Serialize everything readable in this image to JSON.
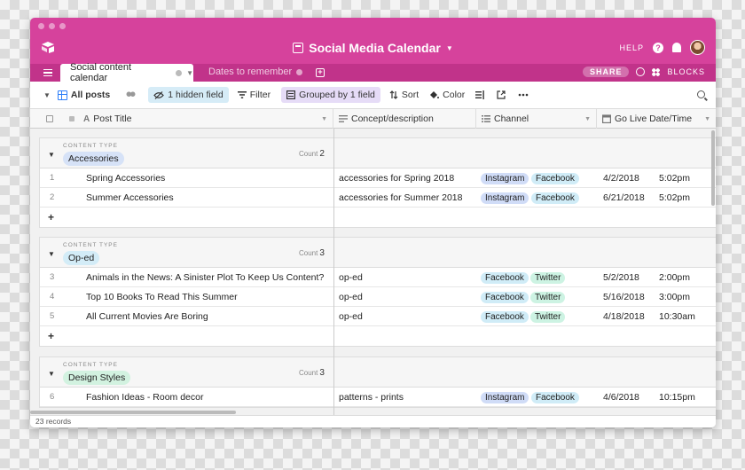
{
  "app": {
    "title": "Social Media Calendar",
    "help_label": "HELP",
    "help_glyph": "?",
    "share_label": "SHARE",
    "blocks_label": "BLOCKS",
    "brand_color": "#d6429c"
  },
  "tabs": {
    "active": "Social content calendar",
    "inactive": "Dates to remember",
    "add_glyph": "+"
  },
  "toolbar": {
    "view_name": "All posts",
    "hidden_fields": "1 hidden field",
    "filter": "Filter",
    "grouped": "Grouped by 1 field",
    "sort": "Sort",
    "color": "Color"
  },
  "columns": {
    "post_title": "Post Title",
    "concept": "Concept/description",
    "channel": "Channel",
    "golive": "Go Live Date/Time"
  },
  "groups": [
    {
      "type_label": "CONTENT TYPE",
      "name": "Accessories",
      "count_label": "Count",
      "count": "2",
      "rows": [
        {
          "num": "1",
          "title": "Spring Accessories",
          "concept": "accessories for Spring 2018",
          "channels": [
            "Instagram",
            "Facebook"
          ],
          "date": "4/2/2018",
          "time": "5:02pm"
        },
        {
          "num": "2",
          "title": "Summer Accessories",
          "concept": "accessories for Summer 2018",
          "channels": [
            "Instagram",
            "Facebook"
          ],
          "date": "6/21/2018",
          "time": "5:02pm"
        }
      ]
    },
    {
      "type_label": "CONTENT TYPE",
      "name": "Op-ed",
      "count_label": "Count",
      "count": "3",
      "rows": [
        {
          "num": "3",
          "title": "Animals in the News: A Sinister Plot To Keep Us Content?",
          "concept": "op-ed",
          "channels": [
            "Facebook",
            "Twitter"
          ],
          "date": "5/2/2018",
          "time": "2:00pm"
        },
        {
          "num": "4",
          "title": "Top 10 Books To Read This Summer",
          "concept": "op-ed",
          "channels": [
            "Facebook",
            "Twitter"
          ],
          "date": "5/16/2018",
          "time": "3:00pm"
        },
        {
          "num": "5",
          "title": "All Current Movies Are Boring",
          "concept": "op-ed",
          "channels": [
            "Facebook",
            "Twitter"
          ],
          "date": "4/18/2018",
          "time": "10:30am"
        }
      ]
    },
    {
      "type_label": "CONTENT TYPE",
      "name": "Design Styles",
      "count_label": "Count",
      "count": "3",
      "rows": [
        {
          "num": "6",
          "title": "Fashion Ideas - Room decor",
          "concept": "patterns - prints",
          "channels": [
            "Instagram",
            "Facebook"
          ],
          "date": "4/6/2018",
          "time": "10:15pm"
        }
      ]
    }
  ],
  "footer": {
    "records": "23 records"
  },
  "add_row_glyph": "+",
  "pill_colors": {
    "Instagram": "#d0dcf7",
    "Facebook": "#d0ecf7",
    "Twitter": "#cdf3e3",
    "Accessories": "#d6e2f7",
    "Op-ed": "#d3ecf7",
    "Design Styles": "#d2f2e0"
  }
}
